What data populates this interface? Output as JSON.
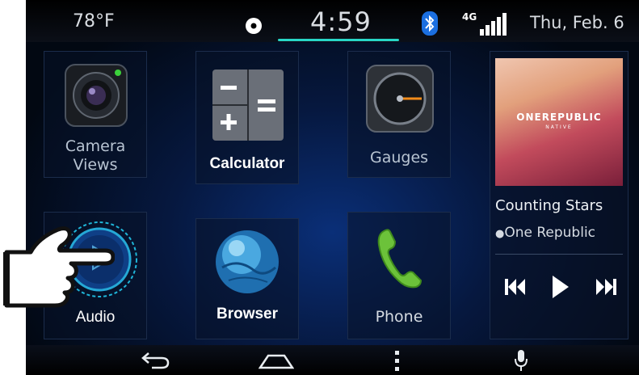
{
  "status": {
    "temperature": "78°F",
    "time": "4:59",
    "network": "4G",
    "date": "Thu, Feb. 6"
  },
  "apps": {
    "camera": "Camera Views",
    "calculator": "Calculator",
    "gauges": "Gauges",
    "audio": "Audio",
    "browser": "Browser",
    "phone": "Phone"
  },
  "now_playing": {
    "album_text": "ONEREPUBLIC",
    "album_subtext": "NATIVE",
    "track": "Counting Stars",
    "artist": "One Republic"
  },
  "colors": {
    "accent": "#28d6c7",
    "gauge_needle": "#f28c1a",
    "phone": "#6cc23a",
    "globe": "#4aa8e0"
  },
  "icons": [
    "disc-icon",
    "bluetooth-icon",
    "signal-icon",
    "camera-icon",
    "calculator-icon",
    "gauge-icon",
    "audio-icon",
    "globe-icon",
    "phone-icon",
    "previous-icon",
    "play-icon",
    "next-icon",
    "back-icon",
    "home-icon",
    "menu-icon",
    "microphone-icon",
    "hand-pointer-icon"
  ]
}
